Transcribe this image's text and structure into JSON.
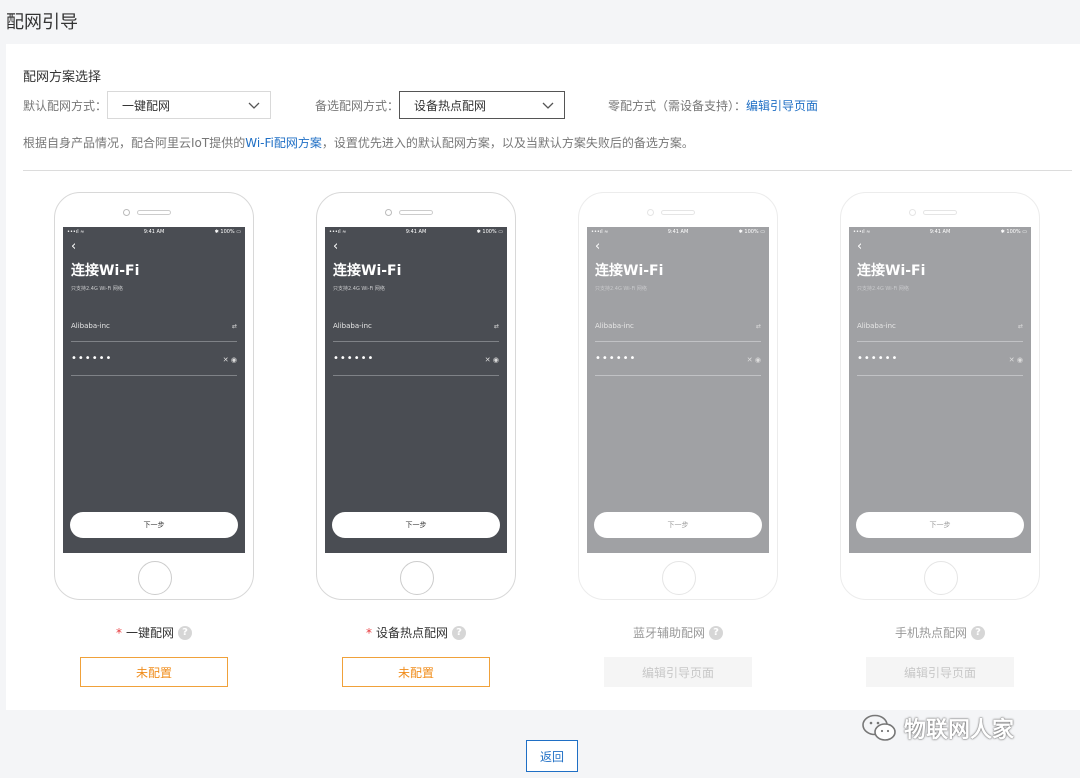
{
  "page": {
    "title": "配网引导"
  },
  "section": {
    "title": "配网方案选择"
  },
  "config": {
    "default_label": "默认配网方式：",
    "default_value": "一键配网",
    "backup_label": "备选配网方式：",
    "backup_value": "设备热点配网",
    "zero_label": "零配方式（需设备支持）：",
    "zero_link": "编辑引导页面"
  },
  "description": {
    "prefix": "根据自身产品情况，配合阿里云IoT提供的",
    "link": "Wi-Fi配网方案",
    "suffix": "，设置优先进入的默认配网方案，以及当默认方案失败后的备选方案。"
  },
  "phone_screen": {
    "status_left": "•••ıl ≈",
    "status_time": "9:41 AM",
    "status_right": "✱ 100% ▭",
    "back": "‹",
    "title": "连接Wi-Fi",
    "hint": "只支持2.4G Wi-Fi 网络",
    "ssid": "Alibaba-inc",
    "ssid_icon": "⇄",
    "password": "••••••",
    "pwd_icons": "✕  ◉",
    "next": "下一步"
  },
  "schemes": [
    {
      "label": "一键配网",
      "required": "*",
      "action": "未配置"
    },
    {
      "label": "设备热点配网",
      "required": "*",
      "action": "未配置"
    },
    {
      "label": "蓝牙辅助配网",
      "required": "",
      "action": "编辑引导页面"
    },
    {
      "label": "手机热点配网",
      "required": "",
      "action": "编辑引导页面"
    }
  ],
  "help_glyph": "?",
  "footer": {
    "return": "返回"
  },
  "watermark": {
    "text": "物联网人家"
  }
}
